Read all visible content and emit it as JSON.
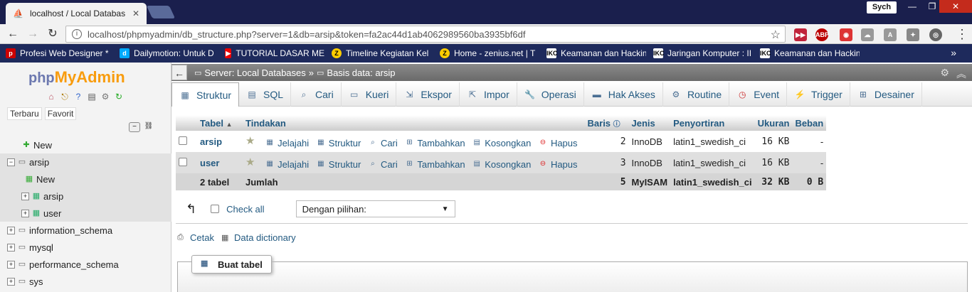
{
  "browser": {
    "tab_title": "localhost / Local Databas",
    "user_chip": "Sych",
    "url": "localhost/phpmyadmin/db_structure.php?server=1&db=arsip&token=fa2ac44d1ab4062989560ba3935bf6df",
    "bookmarks": [
      "Profesi Web Designer *",
      "Dailymotion: Untuk D",
      "TUTORIAL DASAR ME",
      "Timeline Kegiatan Kel",
      "Home - zenius.net | T",
      "Keamanan dan Hackin",
      "Jaringan Komputer : II",
      "Keamanan dan Hackin"
    ]
  },
  "left": {
    "logo_php": "php",
    "logo_myadmin": "MyAdmin",
    "tabs": [
      "Terbaru",
      "Favorit"
    ],
    "tree": {
      "new": "New",
      "db_selected": "arsip",
      "db_new": "New",
      "tables": [
        "arsip",
        "user"
      ],
      "other_dbs": [
        "information_schema",
        "mysql",
        "performance_schema",
        "sys"
      ]
    }
  },
  "main": {
    "breadcrumb": {
      "server": "Server: Local Databases",
      "sep": "»",
      "db": "Basis data: arsip"
    },
    "tabs": [
      "Struktur",
      "SQL",
      "Cari",
      "Kueri",
      "Ekspor",
      "Impor",
      "Operasi",
      "Hak Akses",
      "Routine",
      "Event",
      "Trigger",
      "Desainer"
    ],
    "table_headers": {
      "tabel": "Tabel",
      "tindakan": "Tindakan",
      "baris": "Baris",
      "jenis": "Jenis",
      "penyortiran": "Penyortiran",
      "ukuran": "Ukuran",
      "beban": "Beban"
    },
    "actions": [
      "Jelajahi",
      "Struktur",
      "Cari",
      "Tambahkan",
      "Kosongkan",
      "Hapus"
    ],
    "rows": [
      {
        "name": "arsip",
        "rows": "2",
        "type": "InnoDB",
        "collation": "latin1_swedish_ci",
        "size": "16 KB",
        "overhead": "-"
      },
      {
        "name": "user",
        "rows": "3",
        "type": "InnoDB",
        "collation": "latin1_swedish_ci",
        "size": "16 KB",
        "overhead": "-"
      }
    ],
    "footer": {
      "count": "2 tabel",
      "label": "Jumlah",
      "rows": "5",
      "type": "MyISAM",
      "collation": "latin1_swedish_ci",
      "size": "32 KB",
      "overhead": "0 B"
    },
    "check_all": "Check all",
    "with_selected": "Dengan pilihan:",
    "print": "Cetak",
    "data_dictionary": "Data dictionary",
    "create_table": "Buat tabel"
  }
}
